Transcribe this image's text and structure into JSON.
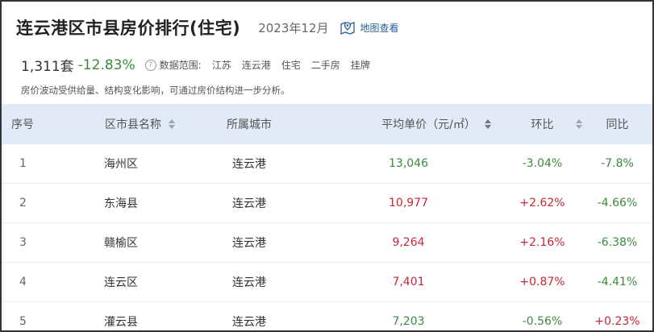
{
  "header": {
    "title": "连云港区市县房价排行(住宅)",
    "date": "2023年12月",
    "map_label": "地图查看"
  },
  "summary": {
    "count": "1,311套",
    "change": "-12.83%",
    "scope_label": "数据范围:",
    "scope": [
      "江苏",
      "连云港",
      "住宅",
      "二手房",
      "挂牌"
    ]
  },
  "note": "房价波动受供给量、结构变化影响，可通过房价结构进一步分析。",
  "table": {
    "headers": [
      "序号",
      "区市县名称",
      "所属城市",
      "平均单价（元/㎡）",
      "环比",
      "同比"
    ],
    "rows": [
      {
        "rank": "1",
        "district": "海州区",
        "city": "连云港",
        "price": "13,046",
        "mom": "-3.04%",
        "yoy": "-7.8%"
      },
      {
        "rank": "2",
        "district": "东海县",
        "city": "连云港",
        "price": "10,977",
        "mom": "+2.62%",
        "yoy": "-4.66%"
      },
      {
        "rank": "3",
        "district": "赣榆区",
        "city": "连云港",
        "price": "9,264",
        "mom": "+2.16%",
        "yoy": "-6.38%"
      },
      {
        "rank": "4",
        "district": "连云区",
        "city": "连云港",
        "price": "7,401",
        "mom": "+0.87%",
        "yoy": "-4.41%"
      },
      {
        "rank": "5",
        "district": "灌云县",
        "city": "连云港",
        "price": "7,203",
        "mom": "-0.56%",
        "yoy": "+0.23%"
      }
    ]
  },
  "colors": {
    "up": "#c8273a",
    "down": "#3c8a3c",
    "header_bg": "#e1ebf7",
    "link": "#2a5c9a"
  }
}
